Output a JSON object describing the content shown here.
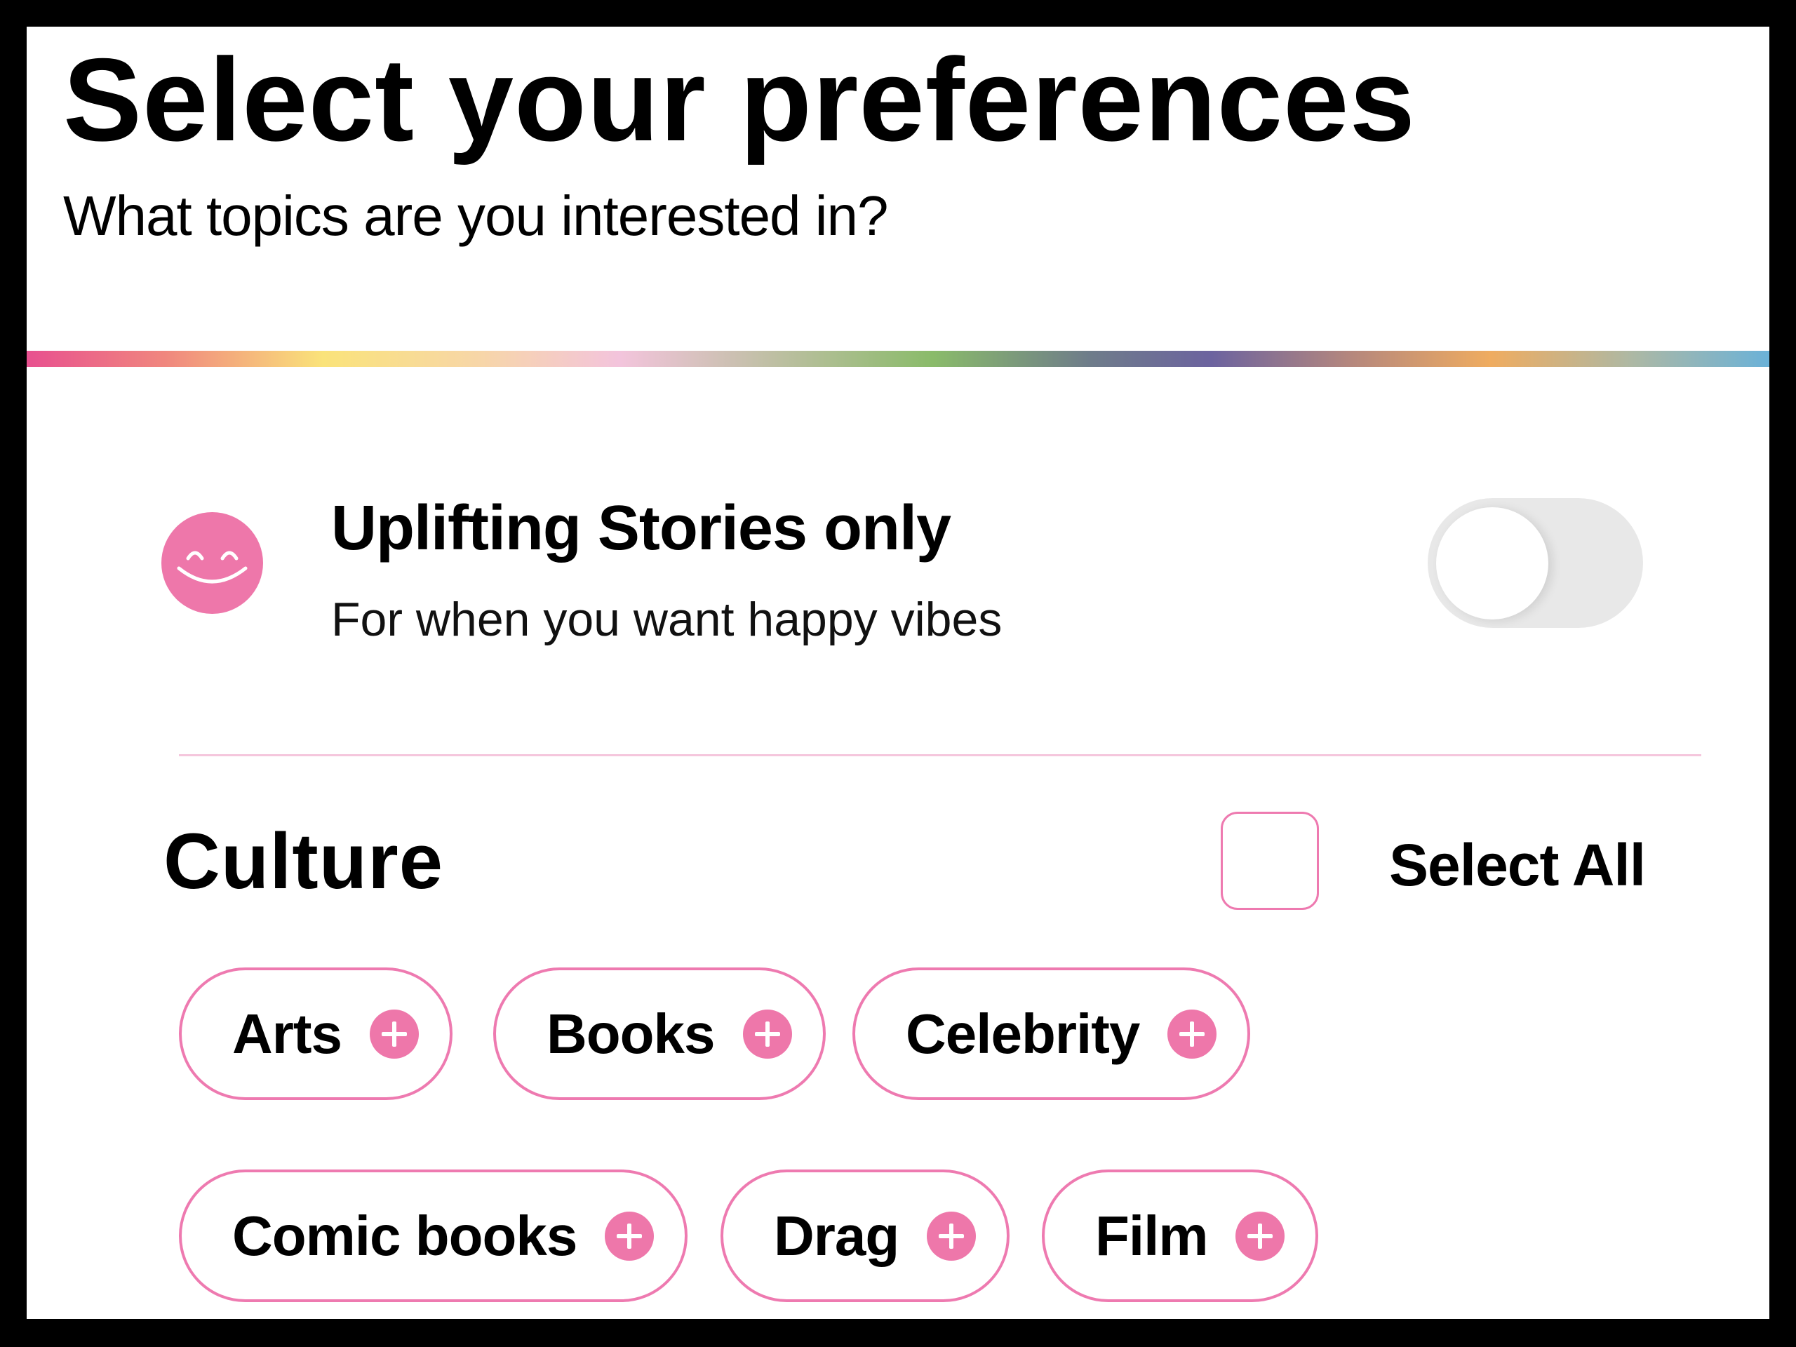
{
  "header": {
    "title": "Select your preferences",
    "subtitle": "What topics are you interested in?"
  },
  "colors": {
    "accent_pink": "#EE77AA",
    "chip_border": "#EE7AB0",
    "divider": "#F5C6DC",
    "toggle_off_track": "#E8E8E8",
    "rainbow_stops": [
      "#E8508F",
      "#FAE37A",
      "#F3C4DC",
      "#8ABB6A",
      "#6C639F",
      "#EFAC60",
      "#6BB2D8"
    ]
  },
  "uplifting": {
    "icon": "smiley-face-icon",
    "title": "Uplifting Stories only",
    "subtitle": "For when you want happy vibes",
    "toggle_on": false
  },
  "section": {
    "title": "Culture",
    "select_all_label": "Select All",
    "select_all_checked": false,
    "chips": [
      {
        "label": "Arts",
        "icon": "plus-circle-icon",
        "selected": false
      },
      {
        "label": "Books",
        "icon": "plus-circle-icon",
        "selected": false
      },
      {
        "label": "Celebrity",
        "icon": "plus-circle-icon",
        "selected": false
      },
      {
        "label": "Comic books",
        "icon": "plus-circle-icon",
        "selected": false
      },
      {
        "label": "Drag",
        "icon": "plus-circle-icon",
        "selected": false
      },
      {
        "label": "Film",
        "icon": "plus-circle-icon",
        "selected": false
      }
    ]
  }
}
